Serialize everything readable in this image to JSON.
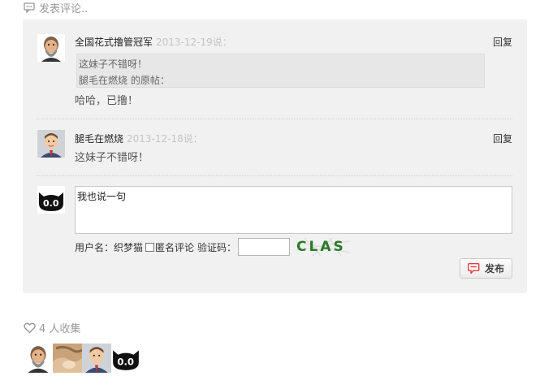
{
  "section_title": "发表评论..",
  "comments": [
    {
      "author": "全国花式撸管冠军",
      "date": "2013-12-19说：",
      "reply_label": "回复",
      "quote_line1": "这妹子不错呀！",
      "quote_line2": "腿毛在燃烧 的原帖：",
      "text": "哈哈，已撸！"
    },
    {
      "author": "腿毛在燃烧",
      "date": "2013-12-18说：",
      "reply_label": "回复",
      "text": "这妹子不错呀！"
    }
  ],
  "composer": {
    "text": "我也说一句",
    "username_label": "用户名：织梦猫",
    "anonymous_label": "匿名评论",
    "captcha_label": "验证码：",
    "captcha_text": "CLAS",
    "publish_label": "发布"
  },
  "favorites": {
    "count_label": "4 人收集"
  },
  "colors": {
    "panel_bg": "#f1f1f1",
    "publish_icon": "#e23b3b",
    "date_gray": "#c4c4c4"
  }
}
